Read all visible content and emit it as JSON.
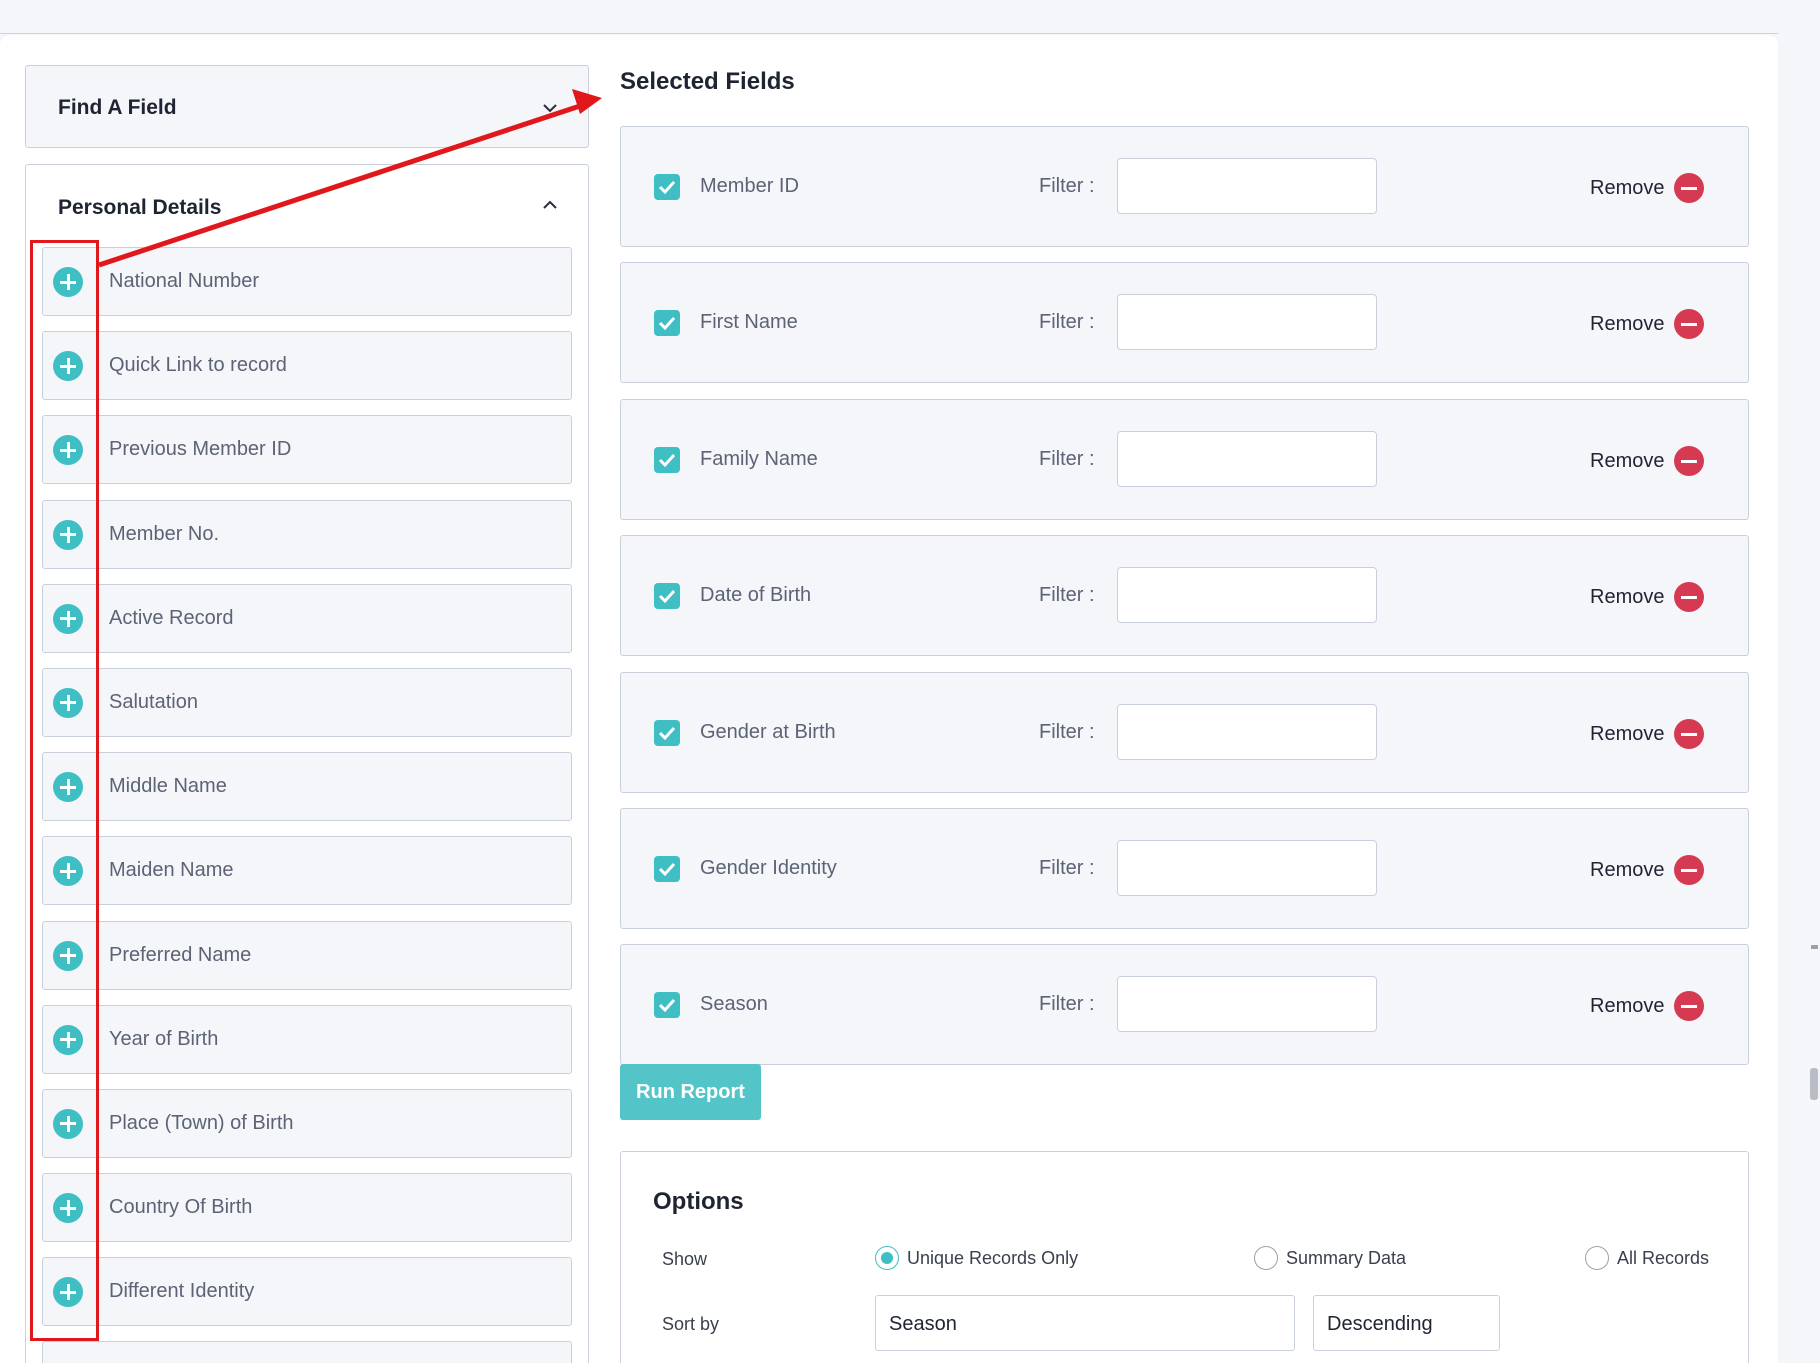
{
  "find_field": {
    "title": "Find A Field"
  },
  "personal_details": {
    "title": "Personal Details",
    "items": [
      {
        "label": "National Number"
      },
      {
        "label": "Quick Link to record"
      },
      {
        "label": "Previous Member ID"
      },
      {
        "label": "Member No."
      },
      {
        "label": "Active Record"
      },
      {
        "label": "Salutation"
      },
      {
        "label": "Middle Name"
      },
      {
        "label": "Maiden Name"
      },
      {
        "label": "Preferred Name"
      },
      {
        "label": "Year of Birth"
      },
      {
        "label": "Place (Town) of Birth"
      },
      {
        "label": "Country Of Birth"
      },
      {
        "label": "Different Identity"
      }
    ]
  },
  "selected": {
    "title": "Selected Fields",
    "filter_label": "Filter :",
    "remove_label": "Remove",
    "rows": [
      {
        "label": "Member ID",
        "checked": true,
        "filter": ""
      },
      {
        "label": "First Name",
        "checked": true,
        "filter": ""
      },
      {
        "label": "Family Name",
        "checked": true,
        "filter": ""
      },
      {
        "label": "Date of Birth",
        "checked": true,
        "filter": ""
      },
      {
        "label": "Gender at Birth",
        "checked": true,
        "filter": ""
      },
      {
        "label": "Gender Identity",
        "checked": true,
        "filter": ""
      },
      {
        "label": "Season",
        "checked": true,
        "filter": ""
      }
    ]
  },
  "run_report": {
    "label": "Run Report"
  },
  "options": {
    "title": "Options",
    "show_label": "Show",
    "radios": [
      {
        "label": "Unique Records Only",
        "selected": true
      },
      {
        "label": "Summary Data",
        "selected": false
      },
      {
        "label": "All Records",
        "selected": false
      }
    ],
    "sort_label": "Sort by",
    "sort_field": "Season",
    "sort_order": "Descending"
  },
  "colors": {
    "accent": "#3fbfc4",
    "remove": "#d63a52",
    "annotation": "#e0171b"
  },
  "icons": {
    "add": "plus-circle-icon",
    "remove": "minus-circle-icon",
    "expand": "chevron-down-icon",
    "collapse": "chevron-up-icon",
    "check": "checkbox-checked-icon"
  }
}
